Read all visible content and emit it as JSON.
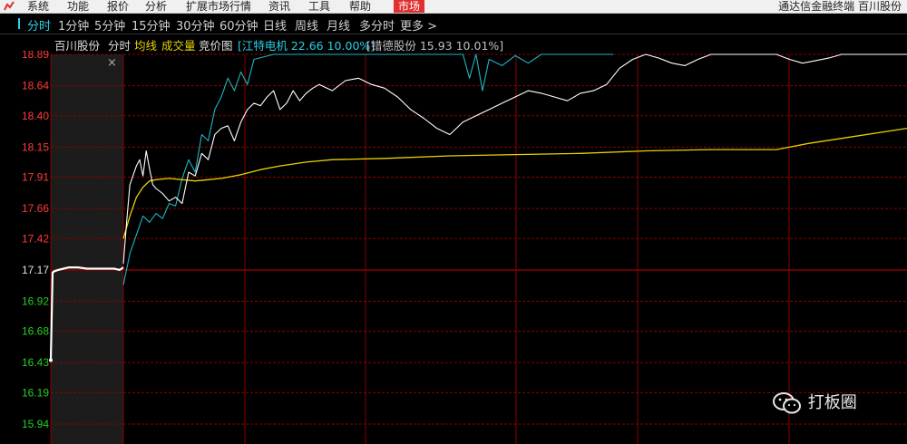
{
  "menubar": {
    "items": [
      "系统",
      "功能",
      "报价",
      "分析",
      "扩展市场行情",
      "资讯",
      "工具",
      "帮助"
    ],
    "active_item": "市场",
    "right_title": "通达信金融终端",
    "right_stock": "百川股份"
  },
  "periods": {
    "tabs": [
      "分时",
      "1分钟",
      "5分钟",
      "15分钟",
      "30分钟",
      "60分钟",
      "日线",
      "周线",
      "月线",
      "多分时",
      "更多"
    ],
    "active_index": 0
  },
  "info": {
    "stock_name": "百川股份",
    "chart_type": "分时",
    "avg_line_label": "均线",
    "volume_label": "成交量",
    "auction_label": "竞价图",
    "compare1": "[江特电机 22.66 10.00%]",
    "compare2": "[错德股份 15.93 10.01%]"
  },
  "colors": {
    "up": "#ff3b3b",
    "down": "#22d022",
    "grid": "#8b0000",
    "price_line": "#ffffff",
    "avg_line": "#e6d200",
    "compare_line": "#1fb5c2",
    "active_tab": "#2ad0e8"
  },
  "chart_data": {
    "type": "line",
    "prev_close": 17.17,
    "ylim": [
      15.94,
      18.89
    ],
    "y_ticks": [
      "18.89",
      "18.64",
      "18.40",
      "18.15",
      "17.91",
      "17.66",
      "17.42",
      "17.17",
      "16.92",
      "16.68",
      "16.43",
      "16.19",
      "15.94"
    ],
    "x_range": [
      0,
      240
    ],
    "auction": {
      "x": [
        -40,
        -39,
        -38,
        -36,
        -33,
        -30,
        -25,
        -20,
        -15,
        -10,
        -5,
        -2,
        0
      ],
      "y": [
        16.45,
        17.15,
        17.16,
        17.17,
        17.18,
        17.19,
        17.19,
        17.18,
        17.18,
        17.18,
        17.18,
        17.17,
        17.19
      ]
    },
    "series": [
      {
        "x": [
          0,
          1,
          2,
          4,
          5,
          6,
          7,
          8,
          9,
          10,
          12,
          14,
          16,
          18,
          20,
          22,
          24,
          26,
          28,
          30,
          32,
          34,
          36,
          38,
          40,
          42,
          44,
          46,
          48,
          50,
          52,
          54,
          56,
          58,
          60,
          64,
          68,
          72,
          76,
          80,
          84,
          88,
          92,
          96,
          100,
          104,
          108,
          112,
          116,
          120,
          124,
          128,
          132,
          136,
          140,
          144,
          148,
          152,
          156,
          160,
          164,
          168,
          172,
          176,
          180,
          184,
          188,
          192,
          196,
          200,
          204,
          208,
          212,
          216,
          220,
          224,
          228,
          232,
          236,
          240
        ],
        "y": [
          17.22,
          17.55,
          17.85,
          18.0,
          18.05,
          17.92,
          18.12,
          17.98,
          17.85,
          17.82,
          17.78,
          17.72,
          17.75,
          17.7,
          17.95,
          17.92,
          18.1,
          18.05,
          18.25,
          18.3,
          18.32,
          18.2,
          18.35,
          18.45,
          18.5,
          18.48,
          18.55,
          18.6,
          18.45,
          18.5,
          18.6,
          18.52,
          18.58,
          18.62,
          18.65,
          18.6,
          18.68,
          18.7,
          18.65,
          18.62,
          18.55,
          18.45,
          18.38,
          18.3,
          18.25,
          18.35,
          18.4,
          18.45,
          18.5,
          18.55,
          18.6,
          18.58,
          18.55,
          18.52,
          18.58,
          18.6,
          18.65,
          18.78,
          18.85,
          18.92,
          18.86,
          18.82,
          18.8,
          18.85,
          18.9,
          18.92,
          18.95,
          18.97,
          18.98,
          18.92,
          18.85,
          18.82,
          18.84,
          18.86,
          18.89,
          18.92,
          18.95,
          18.93,
          18.91,
          18.9
        ],
        "color": "#ffffff"
      },
      {
        "x": [
          0,
          2,
          4,
          6,
          8,
          10,
          14,
          18,
          22,
          26,
          30,
          36,
          42,
          48,
          56,
          64,
          80,
          100,
          120,
          140,
          160,
          180,
          200,
          210,
          220,
          240
        ],
        "y": [
          17.42,
          17.6,
          17.75,
          17.83,
          17.88,
          17.89,
          17.9,
          17.89,
          17.88,
          17.89,
          17.9,
          17.93,
          17.97,
          18.0,
          18.03,
          18.05,
          18.06,
          18.08,
          18.09,
          18.1,
          18.12,
          18.13,
          18.13,
          18.18,
          18.22,
          18.3
        ],
        "color": "#e6d200"
      },
      {
        "x": [
          0,
          2,
          4,
          6,
          8,
          10,
          12,
          14,
          16,
          18,
          20,
          22,
          24,
          26,
          28,
          30,
          32,
          34,
          36,
          38,
          40,
          46,
          52,
          60,
          70,
          80,
          90,
          100,
          104,
          106,
          108,
          110,
          112,
          116,
          120,
          124,
          128,
          132,
          140,
          150
        ],
        "y": [
          17.05,
          17.3,
          17.45,
          17.6,
          17.55,
          17.62,
          17.58,
          17.7,
          17.68,
          17.9,
          18.05,
          17.95,
          18.25,
          18.2,
          18.45,
          18.55,
          18.7,
          18.6,
          18.75,
          18.65,
          18.85,
          18.95,
          19.0,
          19.05,
          19.08,
          19.1,
          19.1,
          19.05,
          18.95,
          18.7,
          18.9,
          18.6,
          18.85,
          18.8,
          18.88,
          18.82,
          18.9,
          18.92,
          18.95,
          18.98
        ],
        "color": "#1fb5c2"
      }
    ]
  },
  "close_glyph": "×",
  "watermark": {
    "icon": "wechat-icon",
    "text": "打板圈"
  }
}
